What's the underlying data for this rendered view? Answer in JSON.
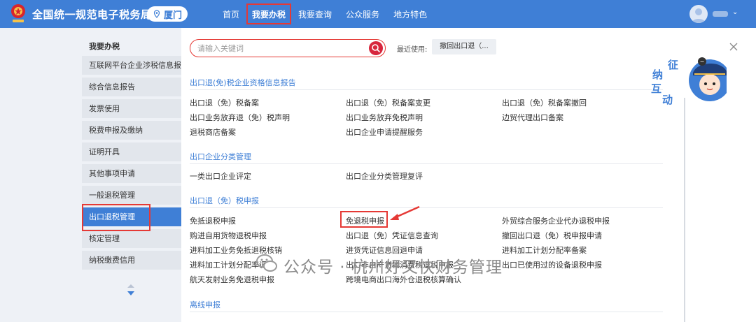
{
  "header": {
    "title": "全国统一规范电子税务局",
    "city": "厦门",
    "nav": [
      {
        "label": "首页"
      },
      {
        "label": "我要办税"
      },
      {
        "label": "我要查询"
      },
      {
        "label": "公众服务"
      },
      {
        "label": "地方特色"
      }
    ],
    "active_nav_index": 1
  },
  "sidebar": {
    "title": "我要办税",
    "items": [
      {
        "label": "互联网平台企业涉税信息报送"
      },
      {
        "label": "综合信息报告"
      },
      {
        "label": "发票使用"
      },
      {
        "label": "税费申报及缴纳"
      },
      {
        "label": "证明开具"
      },
      {
        "label": "其他事项申请"
      },
      {
        "label": "一般退税管理"
      },
      {
        "label": "出口退税管理"
      },
      {
        "label": "核定管理"
      },
      {
        "label": "纳税缴费信用"
      }
    ],
    "active_index": 7
  },
  "search": {
    "placeholder": "请输入关键词",
    "value": ""
  },
  "recent": {
    "label": "最近使用:",
    "chip": "撤回出口退（..."
  },
  "mascot": {
    "text": [
      "征",
      "纳",
      "互",
      "动"
    ]
  },
  "sections": [
    {
      "title": "出口退(免)税企业资格信息报告",
      "items": [
        "出口退（免）税备案",
        "出口退（免）税备案变更",
        "出口退（免）税备案撤回",
        "出口业务放弃退（免）税声明",
        "出口业务放弃免税声明",
        "边贸代理出口备案",
        "退税商店备案",
        "出口企业申请提醒服务"
      ]
    },
    {
      "title": "出口企业分类管理",
      "items": [
        "一类出口企业评定",
        "出口企业分类管理复评"
      ]
    },
    {
      "title": "出口退（免）税申报",
      "items": [
        "免抵退税申报",
        "免退税申报",
        "外贸综合服务企业代办退税申报",
        "购进自用货物退税申报",
        "出口退（免）凭证信息查询",
        "撤回出口退（免）税申报申请",
        "进料加工业务免抵退税核销",
        "进货凭证信息回退申请",
        "进料加工计划分配率备案",
        "进料加工计划分配率调整",
        "出口非自产货物消费税退税申报",
        "出口已使用过的设备退税申报",
        "航天发射业务免退税申报",
        "跨境电商出口海外仓退税核算确认"
      ]
    },
    {
      "title": "离线申报",
      "items": []
    }
  ],
  "watermark": {
    "text": "公众号 · 杭州好又快财务管理"
  },
  "colors": {
    "primary": "#3f7fd6",
    "highlight_red": "#e53935",
    "search_button": "#d7263d",
    "sidebar_bg": "#eef1f6"
  }
}
